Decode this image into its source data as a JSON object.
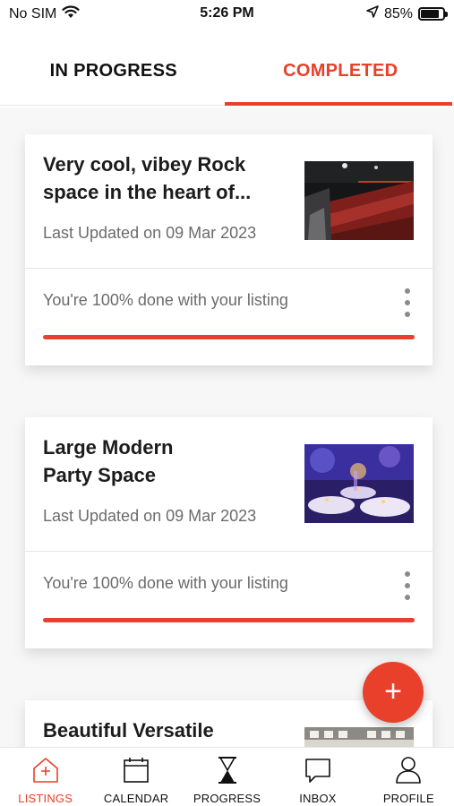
{
  "status_bar": {
    "carrier": "No SIM",
    "time": "5:26 PM",
    "battery": "85%",
    "battery_level": 0.85
  },
  "tabs": [
    {
      "label": "IN PROGRESS",
      "active": false
    },
    {
      "label": "COMPLETED",
      "active": true
    }
  ],
  "listings": [
    {
      "title": "Very cool, vibey Rock space in the heart of...",
      "last_updated": "Last Updated on 09 Mar 2023",
      "progress_text": "You're 100% done with your listing",
      "progress": 1.0
    },
    {
      "title": "Large Modern Party Space",
      "last_updated": "Last Updated on 09 Mar 2023",
      "progress_text": "You're 100% done with your listing",
      "progress": 1.0
    },
    {
      "title": "Beautiful Versatile"
    }
  ],
  "fab": {
    "icon": "plus-icon",
    "label": "+"
  },
  "bottom_nav": [
    {
      "label": "LISTINGS",
      "icon": "home-plus-icon",
      "active": true
    },
    {
      "label": "CALENDAR",
      "icon": "calendar-icon",
      "active": false
    },
    {
      "label": "PROGRESS",
      "icon": "hourglass-icon",
      "active": false
    },
    {
      "label": "INBOX",
      "icon": "chat-bubble-icon",
      "active": false
    },
    {
      "label": "PROFILE",
      "icon": "person-icon",
      "active": false
    }
  ],
  "colors": {
    "accent": "#e8402b",
    "text_primary": "#1c1c1c",
    "text_secondary": "#6b6b6b",
    "background": "#f7f7f7"
  }
}
